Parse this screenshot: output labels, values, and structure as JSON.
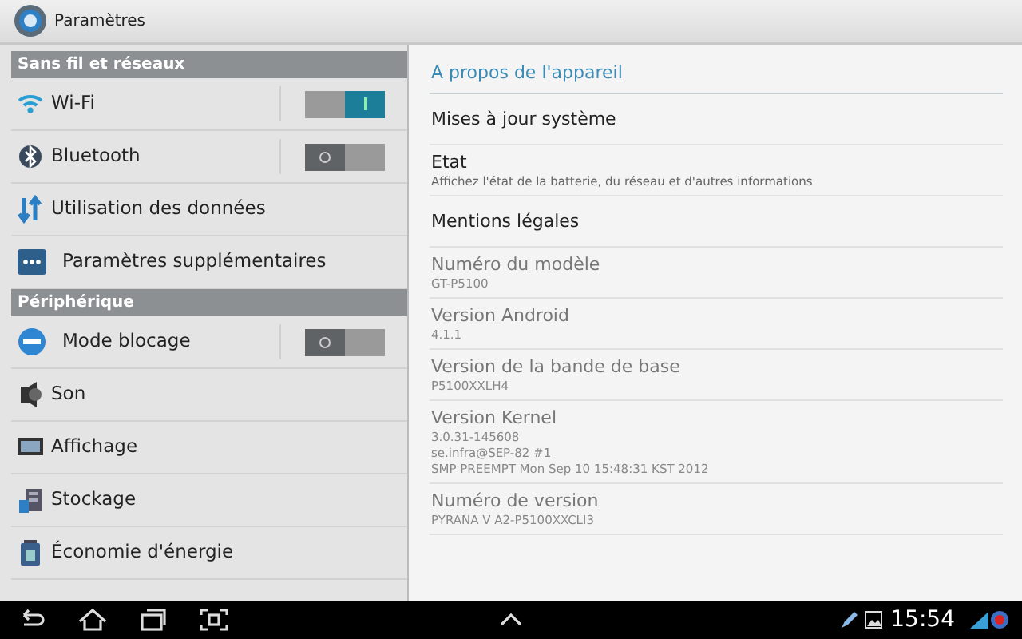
{
  "window": {
    "title": "Paramètres"
  },
  "sidebar": {
    "sections": [
      {
        "header": "Sans fil et réseaux",
        "items": [
          {
            "label": "Wi-Fi",
            "kind": "toggle",
            "on": true
          },
          {
            "label": "Bluetooth",
            "kind": "toggle",
            "on": false
          },
          {
            "label": "Utilisation des données",
            "kind": "plain"
          },
          {
            "label": "Paramètres supplémentaires",
            "kind": "plain"
          }
        ]
      },
      {
        "header": "Périphérique",
        "items": [
          {
            "label": "Mode blocage",
            "kind": "toggle",
            "on": false
          },
          {
            "label": "Son",
            "kind": "plain"
          },
          {
            "label": "Affichage",
            "kind": "plain"
          },
          {
            "label": "Stockage",
            "kind": "plain"
          },
          {
            "label": "Économie d'énergie",
            "kind": "plain"
          }
        ]
      }
    ]
  },
  "detail": {
    "title": "A propos de l'appareil",
    "items": [
      {
        "kind": "action",
        "title": "Mises à jour système"
      },
      {
        "kind": "action",
        "title": "Etat",
        "lines": [
          "Affichez l'état de la batterie, du réseau et d'autres informations"
        ]
      },
      {
        "kind": "action",
        "title": "Mentions légales"
      },
      {
        "kind": "info",
        "title": "Numéro du modèle",
        "lines": [
          "GT-P5100"
        ]
      },
      {
        "kind": "info",
        "title": "Version Android",
        "lines": [
          "4.1.1"
        ]
      },
      {
        "kind": "info",
        "title": "Version de la bande de base",
        "lines": [
          "P5100XXLH4"
        ]
      },
      {
        "kind": "info",
        "title": "Version Kernel",
        "lines": [
          "3.0.31-145608",
          "se.infra@SEP-82 #1",
          "SMP PREEMPT Mon Sep 10 15:48:31 KST 2012"
        ]
      },
      {
        "kind": "info",
        "title": "Numéro de version",
        "lines": [
          "PYRANA V A2-P5100XXCLI3"
        ]
      }
    ]
  },
  "status_bar": {
    "time": "15:54"
  }
}
